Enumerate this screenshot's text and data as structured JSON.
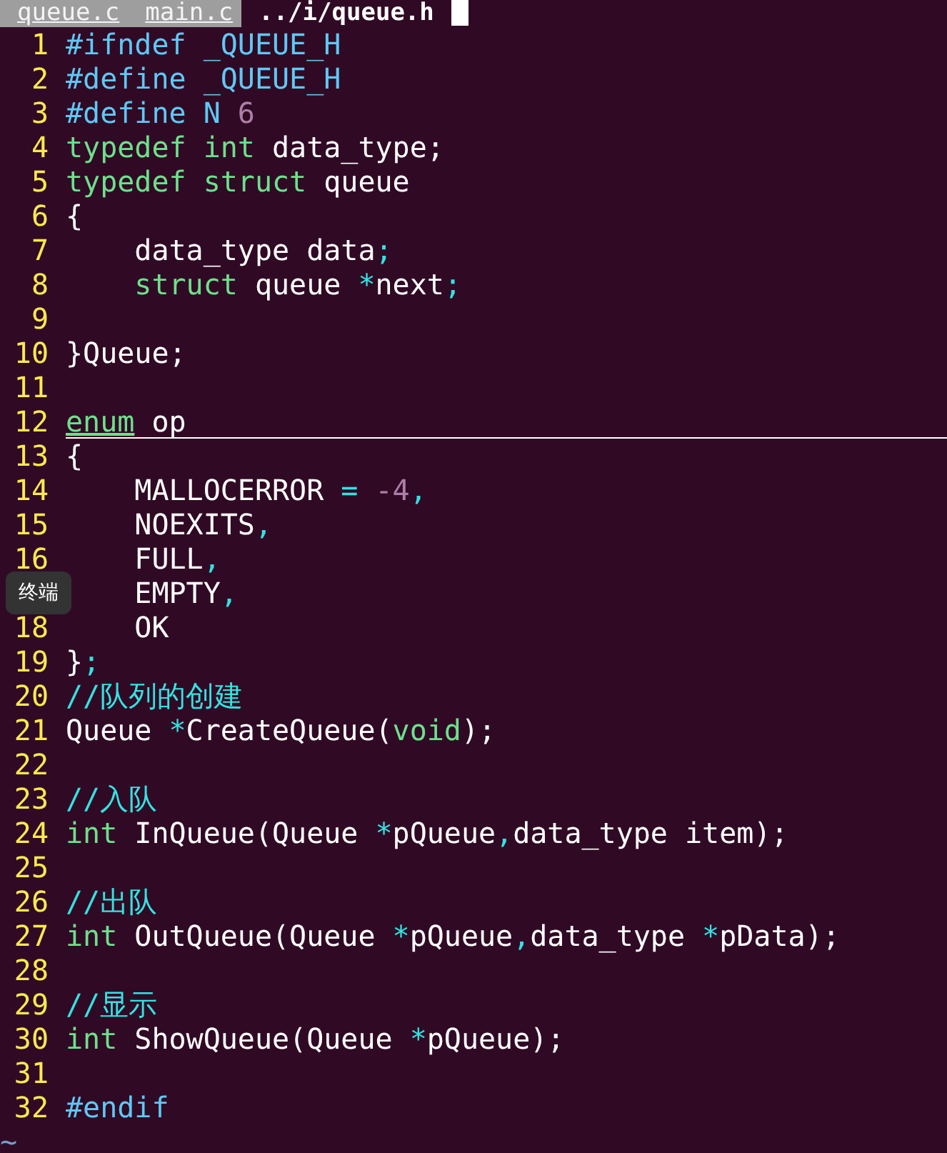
{
  "tabs": [
    {
      "label": "queue.c",
      "selected": false
    },
    {
      "label": "main.c",
      "selected": false
    },
    {
      "label": "../i/queue.h",
      "selected": true
    }
  ],
  "lines": [
    {
      "number": "1",
      "cursor": false,
      "tokens": [
        {
          "kind": "preproc",
          "text": "#ifndef _QUEUE_H"
        }
      ]
    },
    {
      "number": "2",
      "cursor": false,
      "tokens": [
        {
          "kind": "preproc",
          "text": "#define _QUEUE_H"
        }
      ]
    },
    {
      "number": "3",
      "cursor": false,
      "tokens": [
        {
          "kind": "preproc",
          "text": "#define N "
        },
        {
          "kind": "number",
          "text": "6"
        }
      ]
    },
    {
      "number": "4",
      "cursor": false,
      "tokens": [
        {
          "kind": "type",
          "text": "typedef int"
        },
        {
          "kind": "plain",
          "text": " data_type;"
        }
      ]
    },
    {
      "number": "5",
      "cursor": false,
      "tokens": [
        {
          "kind": "type",
          "text": "typedef struct"
        },
        {
          "kind": "plain",
          "text": " queue"
        }
      ]
    },
    {
      "number": "6",
      "cursor": false,
      "tokens": [
        {
          "kind": "plain",
          "text": "{"
        }
      ]
    },
    {
      "number": "7",
      "cursor": false,
      "tokens": [
        {
          "kind": "plain",
          "text": "    data_type data"
        },
        {
          "kind": "operator",
          "text": ";"
        }
      ]
    },
    {
      "number": "8",
      "cursor": false,
      "tokens": [
        {
          "kind": "type",
          "text": "    struct"
        },
        {
          "kind": "plain",
          "text": " queue "
        },
        {
          "kind": "operator",
          "text": "*"
        },
        {
          "kind": "plain",
          "text": "next"
        },
        {
          "kind": "operator",
          "text": ";"
        }
      ]
    },
    {
      "number": "9",
      "cursor": false
    },
    {
      "number": "10",
      "cursor": false,
      "tokens": [
        {
          "kind": "plain",
          "text": "}Queue;"
        }
      ]
    },
    {
      "number": "11",
      "cursor": false
    },
    {
      "number": "12",
      "cursor": true,
      "tokens": [
        {
          "kind": "type",
          "text": "enum"
        },
        {
          "kind": "plain",
          "text": " op"
        }
      ]
    },
    {
      "number": "13",
      "cursor": false,
      "tokens": [
        {
          "kind": "plain",
          "text": "{"
        }
      ]
    },
    {
      "number": "14",
      "cursor": false,
      "tokens": [
        {
          "kind": "plain",
          "text": "    MALLOCERROR "
        },
        {
          "kind": "operator",
          "text": "= "
        },
        {
          "kind": "number",
          "text": "-4"
        },
        {
          "kind": "operator",
          "text": ","
        }
      ]
    },
    {
      "number": "15",
      "cursor": false,
      "tokens": [
        {
          "kind": "plain",
          "text": "    NOEXITS"
        },
        {
          "kind": "operator",
          "text": ","
        }
      ]
    },
    {
      "number": "16",
      "cursor": false,
      "tokens": [
        {
          "kind": "plain",
          "text": "    FULL"
        },
        {
          "kind": "operator",
          "text": ","
        }
      ]
    },
    {
      "cursor": false,
      "tokens": [
        {
          "kind": "plain",
          "text": "    EMPTY"
        },
        {
          "kind": "operator",
          "text": ","
        }
      ]
    },
    {
      "number": "18",
      "cursor": false,
      "tokens": [
        {
          "kind": "plain",
          "text": "    OK"
        }
      ]
    },
    {
      "number": "19",
      "cursor": false,
      "tokens": [
        {
          "kind": "plain",
          "text": "}"
        },
        {
          "kind": "operator",
          "text": ";"
        }
      ]
    },
    {
      "number": "20",
      "cursor": false,
      "tokens": [
        {
          "kind": "comment",
          "text": "//队列的创建"
        }
      ]
    },
    {
      "number": "21",
      "cursor": false,
      "tokens": [
        {
          "kind": "plain",
          "text": "Queue "
        },
        {
          "kind": "operator",
          "text": "*"
        },
        {
          "kind": "plain",
          "text": "CreateQueue("
        },
        {
          "kind": "type",
          "text": "void"
        },
        {
          "kind": "plain",
          "text": ");"
        }
      ]
    },
    {
      "number": "22",
      "cursor": false
    },
    {
      "number": "23",
      "cursor": false,
      "tokens": [
        {
          "kind": "comment",
          "text": "//入队"
        }
      ]
    },
    {
      "number": "24",
      "cursor": false,
      "tokens": [
        {
          "kind": "type",
          "text": "int"
        },
        {
          "kind": "plain",
          "text": " InQueue(Queue "
        },
        {
          "kind": "operator",
          "text": "*"
        },
        {
          "kind": "plain",
          "text": "pQueue"
        },
        {
          "kind": "operator",
          "text": ","
        },
        {
          "kind": "plain",
          "text": "data_type item);"
        }
      ]
    },
    {
      "number": "25",
      "cursor": false
    },
    {
      "number": "26",
      "cursor": false,
      "tokens": [
        {
          "kind": "comment",
          "text": "//出队"
        }
      ]
    },
    {
      "number": "27",
      "cursor": false,
      "tokens": [
        {
          "kind": "type",
          "text": "int"
        },
        {
          "kind": "plain",
          "text": " OutQueue(Queue "
        },
        {
          "kind": "operator",
          "text": "*"
        },
        {
          "kind": "plain",
          "text": "pQueue"
        },
        {
          "kind": "operator",
          "text": ","
        },
        {
          "kind": "plain",
          "text": "data_type "
        },
        {
          "kind": "operator",
          "text": "*"
        },
        {
          "kind": "plain",
          "text": "pData);"
        }
      ]
    },
    {
      "number": "28",
      "cursor": false
    },
    {
      "number": "29",
      "cursor": false,
      "tokens": [
        {
          "kind": "comment",
          "text": "//显示"
        }
      ]
    },
    {
      "number": "30",
      "cursor": false,
      "tokens": [
        {
          "kind": "type",
          "text": "int"
        },
        {
          "kind": "plain",
          "text": " ShowQueue(Queue "
        },
        {
          "kind": "operator",
          "text": "*"
        },
        {
          "kind": "plain",
          "text": "pQueue);"
        }
      ]
    },
    {
      "number": "31",
      "cursor": false
    },
    {
      "number": "32",
      "cursor": false,
      "tokens": [
        {
          "kind": "preproc",
          "text": "#endif"
        }
      ]
    }
  ],
  "filler": "~",
  "tooltip": {
    "text": "终端"
  }
}
